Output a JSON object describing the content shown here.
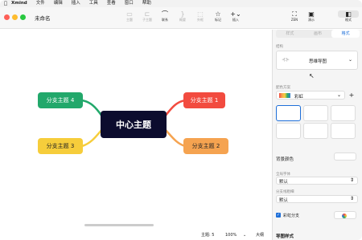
{
  "menubar": {
    "items": [
      "Xmind",
      "文件",
      "编辑",
      "插入",
      "工具",
      "查看",
      "窗口",
      "帮助"
    ]
  },
  "window": {
    "title": "未命名"
  },
  "toolbar": {
    "buttons": [
      "主题",
      "子主题",
      "联系",
      "概要",
      "外框",
      "标记",
      "插入"
    ],
    "right_buttons": [
      "ZEN",
      "演示",
      "格式"
    ]
  },
  "mindmap": {
    "central": "中心主题",
    "branches": [
      "分支主题 1",
      "分支主题 2",
      "分支主题 3",
      "分支主题 4"
    ],
    "colors": {
      "b1": "#f24b3f",
      "b2": "#f5a350",
      "b3": "#f6cd3b",
      "b4": "#22a86b",
      "central": "#0c0c2e"
    }
  },
  "panel": {
    "tabs": [
      "样式",
      "画布",
      "格式"
    ],
    "structure_label": "结构",
    "structure_value": "思维导图",
    "scheme_label": "配色方案",
    "scheme_value": "彩虹",
    "bg_label": "背景颜色",
    "theme_font_label": "全局字体",
    "theme_font_value": "默认",
    "branch_line_label": "分支线粗细",
    "branch_line_value": "默认",
    "rainbow_label": "彩虹分支",
    "map_style_label": "导图样式"
  },
  "status": {
    "topics": "主题: 5",
    "zoom": "100%",
    "size": "大纲"
  },
  "accent": "#1e6fd9"
}
